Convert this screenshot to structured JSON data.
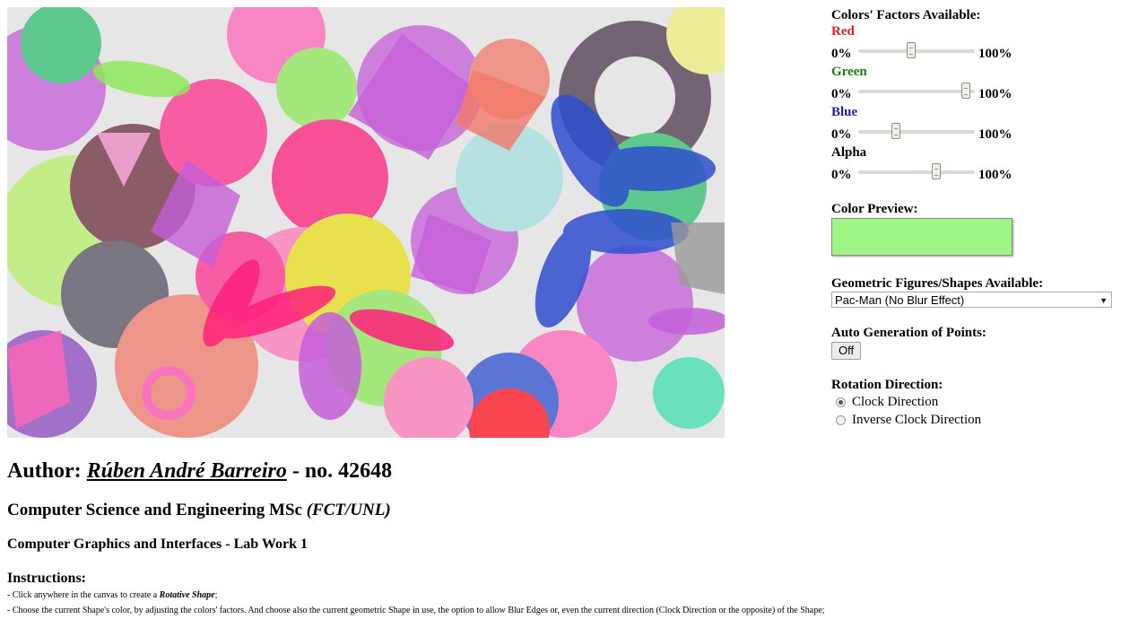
{
  "canvas": {
    "background": "#e6e6e6",
    "description_colors": [
      "#c55fd8",
      "#ff2e8c",
      "#9be86a",
      "#5a4a5a",
      "#2f4fcf"
    ]
  },
  "panel": {
    "factors_title": "Colors' Factors Available:",
    "sliders": [
      {
        "label": "Red",
        "color": "#e0201e",
        "min": "0%",
        "max": "100%",
        "value": 0.45
      },
      {
        "label": "Green",
        "color": "#1f7a1f",
        "min": "0%",
        "max": "100%",
        "value": 0.92
      },
      {
        "label": "Blue",
        "color": "#1e1ea0",
        "min": "0%",
        "max": "100%",
        "value": 0.32
      },
      {
        "label": "Alpha",
        "color": "#000000",
        "min": "0%",
        "max": "100%",
        "value": 0.67
      }
    ],
    "preview_title": "Color Preview:",
    "preview_color": "#9cf585",
    "shapes_title": "Geometric Figures/Shapes Available:",
    "shape_selected": "Pac-Man (No Blur Effect)",
    "auto_title": "Auto Generation of Points:",
    "auto_button": "Off",
    "rotation_title": "Rotation Direction:",
    "rotation_options": [
      {
        "label": "Clock Direction",
        "checked": true
      },
      {
        "label": "Inverse Clock Direction",
        "checked": false
      }
    ]
  },
  "info": {
    "author_prefix": "Author:",
    "author_name": "Rúben André Barreiro",
    "author_suffix": "- no. 42648",
    "degree": "Computer Science and Engineering MSc",
    "institution": "(FCT/UNL)",
    "course": "Computer Graphics and Interfaces - Lab Work 1",
    "instructions_title": "Instructions:",
    "instruction_1_pre": "- Click anywhere in the canvas to create a",
    "instruction_1_em": "Rotative Shape",
    "instruction_1_post": ";",
    "instruction_2": "- Choose the current Shape's color, by adjusting the colors' factors. And choose also the current geometric Shape in use, the option to allow Blur Edges or, even the current direction (Clock Direction or the opposite) of the Shape;"
  }
}
